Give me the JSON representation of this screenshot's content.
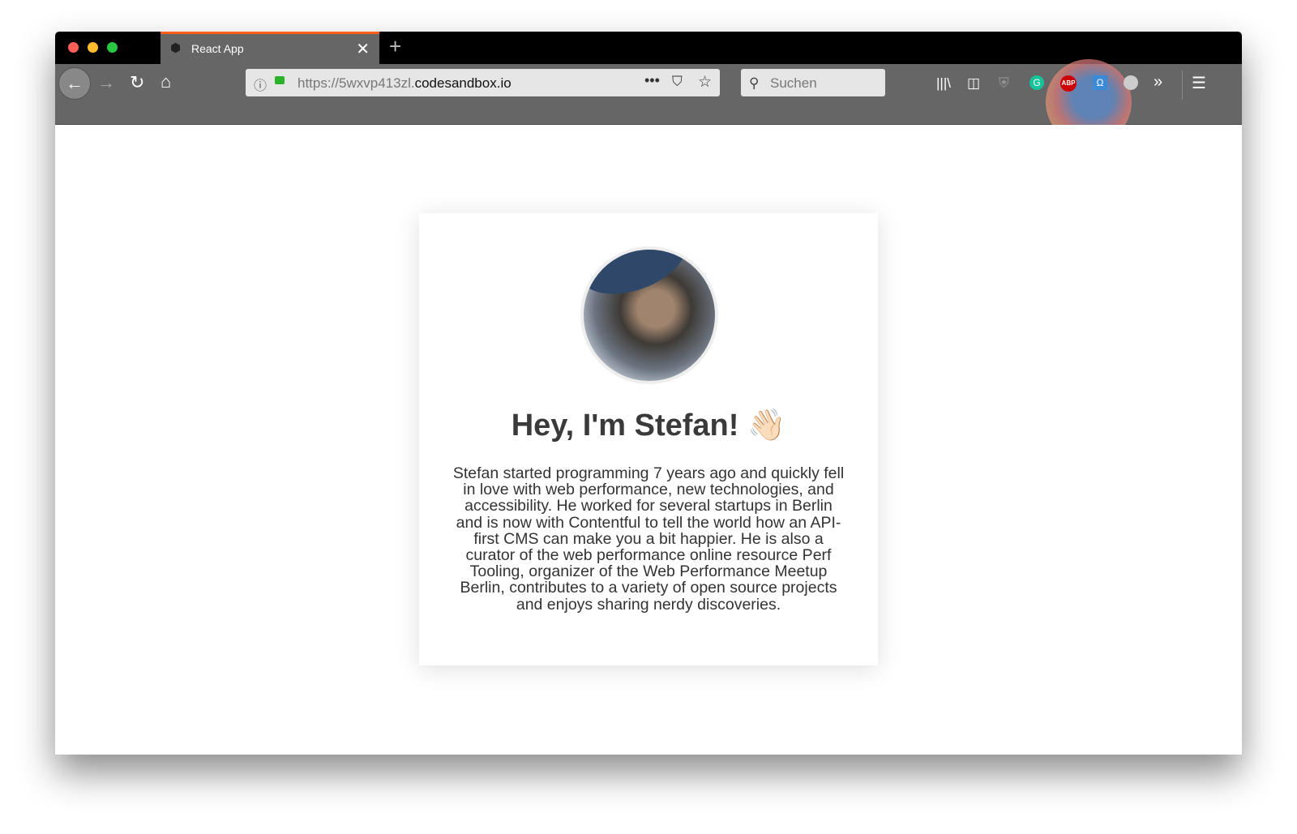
{
  "browser": {
    "tab_title": "React App",
    "url_prefix": "https://5wxvp413zl.",
    "url_domain": "codesandbox.io",
    "search_placeholder": "Suchen",
    "accent_color": "#ff5e1a",
    "toolbar_icons": [
      "library-icon",
      "sidebar-icon",
      "tracking-shield-icon",
      "grammarly-icon",
      "adblock-plus-icon",
      "octotree-icon",
      "extension-icon",
      "overflow-icon",
      "menu-icon"
    ],
    "adblock_label": "ABP"
  },
  "page": {
    "heading": "Hey, I'm Stefan! 👋🏻",
    "bio": "Stefan started programming 7 years ago and quickly fell\nin love with web performance, new technologies, and\naccessibility. He worked for several startups in Berlin\nand is now with Contentful to tell the world how an API-\nfirst CMS can make you a bit happier. He is also a\ncurator of the web performance online resource Perf\nTooling, organizer of the Web Performance Meetup\nBerlin, contributes to a variety of open source projects\nand enjoys sharing nerdy discoveries."
  }
}
